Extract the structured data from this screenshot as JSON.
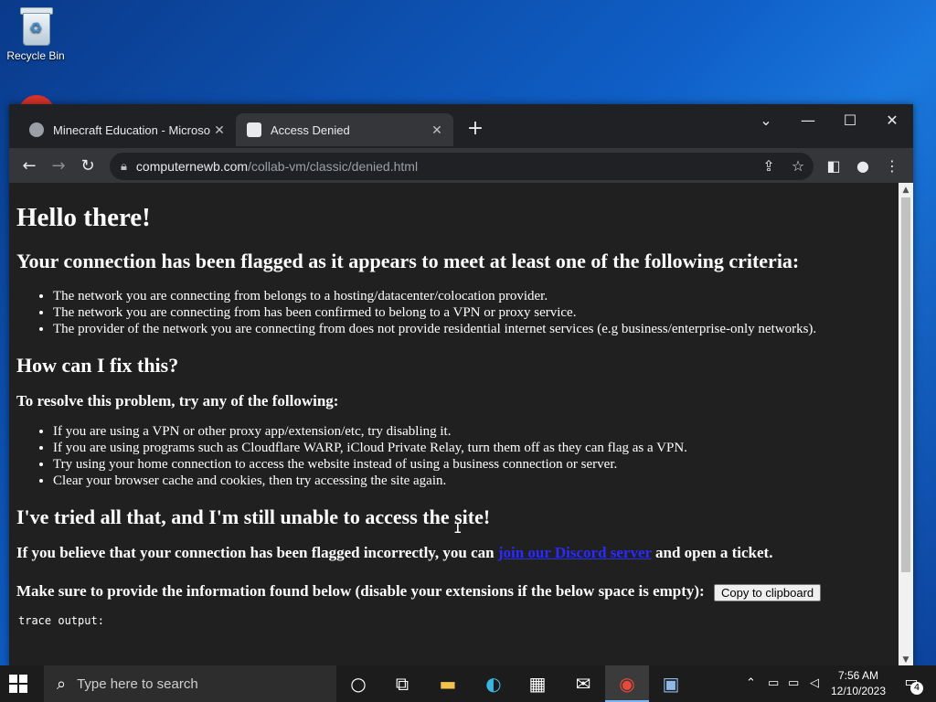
{
  "desktop": {
    "recycle_bin_label": "Recycle Bin"
  },
  "tabs": [
    {
      "title": "Minecraft Education - Microsoft",
      "close": "✕"
    },
    {
      "title": "Access Denied",
      "close": "✕"
    }
  ],
  "new_tab": "+",
  "window_controls": {
    "dropdown": "⌄",
    "minimize": "—",
    "maximize": "☐",
    "close": "✕"
  },
  "address": {
    "host": "computernewb.com",
    "path": "/collab-vm/classic/denied.html"
  },
  "page": {
    "h1": "Hello there!",
    "h2_flagged": "Your connection has been flagged as it appears to meet at least one of the following criteria:",
    "criteria": [
      "The network you are connecting from belongs to a hosting/datacenter/colocation provider.",
      "The network you are connecting from has been confirmed to belong to a VPN or proxy service.",
      "The provider of the network you are connecting from does not provide residential internet services (e.g business/enterprise-only networks)."
    ],
    "h2_fix": "How can I fix this?",
    "h3_resolve": "To resolve this problem, try any of the following:",
    "fixes": [
      "If you are using a VPN or other proxy app/extension/etc, try disabling it.",
      "If you are using programs such as Cloudflare WARP, iCloud Private Relay, turn them off as they can flag as a VPN.",
      "Try using your home connection to access the website instead of using a business connection or server.",
      "Clear your browser cache and cookies, then try accessing the site again."
    ],
    "h2_tried": "I've tried all that, and I'm still unable to access the site!",
    "believe_pre": "If you believe that your connection has been flagged incorrectly, you can ",
    "discord_link": "join our Discord server",
    "believe_post": " and open a ticket.",
    "make_sure": "Make sure to provide the information found below (disable your extensions if the below space is empty):",
    "copy_button": "Copy to clipboard",
    "trace_label": "trace output:"
  },
  "taskbar": {
    "search_placeholder": "Type here to search",
    "time": "7:56 AM",
    "date": "12/10/2023",
    "notification_count": "4"
  }
}
